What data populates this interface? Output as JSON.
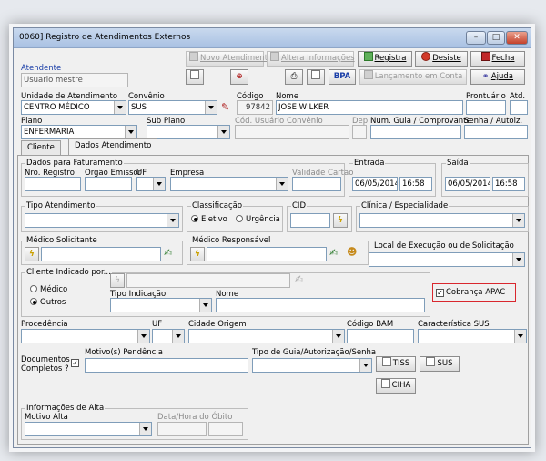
{
  "window": {
    "title": "0060] Registro de Atendimentos Externos",
    "minimize": "–",
    "maximize": "□",
    "close": "✕"
  },
  "toolbar": {
    "novo_atendimento": "Novo Atendimento",
    "altera_informacoes": "Altera Informações",
    "registra": "Registra",
    "desiste": "Desiste",
    "fecha": "Fecha",
    "bpa": "BPA",
    "lancamento_em_conta": "Lançamento em Conta",
    "ajuda": "Ajuda"
  },
  "atendente": {
    "label": "Atendente",
    "value": "Usuario mestre"
  },
  "unidade": {
    "label": "Unidade de Atendimento",
    "value": "CENTRO MÉDICO"
  },
  "convenio": {
    "label": "Convênio",
    "value": "SUS"
  },
  "codigo": {
    "label": "Código",
    "value": "97842"
  },
  "nome": {
    "label": "Nome",
    "value": "JOSE WILKER"
  },
  "prontuario": {
    "label": "Prontuário",
    "value": ""
  },
  "atd": {
    "label": "Atd.",
    "value": ""
  },
  "plano": {
    "label": "Plano",
    "value": "ENFERMARIA"
  },
  "sub_plano": {
    "label": "Sub Plano",
    "value": ""
  },
  "cod_usuario_convenio": {
    "label": "Cód. Usuário Convênio",
    "value": ""
  },
  "dep": {
    "label": "Dep.",
    "value": ""
  },
  "num_guia": {
    "label": "Num. Guia / Comprovante",
    "value": ""
  },
  "senha": {
    "label": "Senha / Autoiz.",
    "value": ""
  },
  "tabs": [
    {
      "label": "Cliente"
    },
    {
      "label": "Dados Atendimento"
    }
  ],
  "faturamento": {
    "legend": "Dados para Faturamento",
    "nro_registro": "Nro. Registro",
    "orgao_emissor": "Orgão Emissor",
    "uf": "UF",
    "empresa": "Empresa",
    "validade_cartao": "Validade Cartão"
  },
  "entrada": {
    "legend": "Entrada",
    "date": "06/05/2014",
    "time": "16:58"
  },
  "saida": {
    "legend": "Saída",
    "date": "06/05/2014",
    "time": "16:58"
  },
  "tipo_atendimento": {
    "legend": "Tipo Atendimento"
  },
  "classificacao": {
    "legend": "Classificação",
    "eletivo": "Eletivo",
    "urgencia": "Urgência",
    "selected": "Eletivo"
  },
  "cid": {
    "legend": "CID"
  },
  "clinica": {
    "legend": "Clínica / Especialidade"
  },
  "medico_solicitante": {
    "legend": "Médico Solicitante"
  },
  "medico_responsavel": {
    "legend": "Médico Responsável"
  },
  "local_execucao": {
    "legend": "Local de Execução ou de Solicitação"
  },
  "cliente_indicado": {
    "legend": "Cliente Indicado por...",
    "medico": "Médico",
    "outros": "Outros",
    "selected": "Outros",
    "tipo_indicacao": "Tipo Indicação",
    "nome": "Nome"
  },
  "cobranca_apac": {
    "label": "Cobrança APAC",
    "checked": true
  },
  "procedencia": {
    "label": "Procedência"
  },
  "uf2": {
    "label": "UF"
  },
  "cidade_origem": {
    "label": "Cidade Origem"
  },
  "codigo_bam": {
    "label": "Código BAM"
  },
  "caracteristica_sus": {
    "label": "Característica SUS"
  },
  "documentos": {
    "label_1": "Documentos",
    "label_2": "Completos ?",
    "checked": true
  },
  "motivo_pendencia": {
    "label": "Motivo(s) Pendência"
  },
  "tipo_guia": {
    "label": "Tipo de Guia/Autorização/Senha"
  },
  "buttons": {
    "tiss": "TISS",
    "sus": "SUS",
    "ciha": "CIHA"
  },
  "alta": {
    "legend": "Informações de Alta",
    "motivo": "Motivo Alta",
    "data_obito": "Data/Hora do Óbito"
  }
}
